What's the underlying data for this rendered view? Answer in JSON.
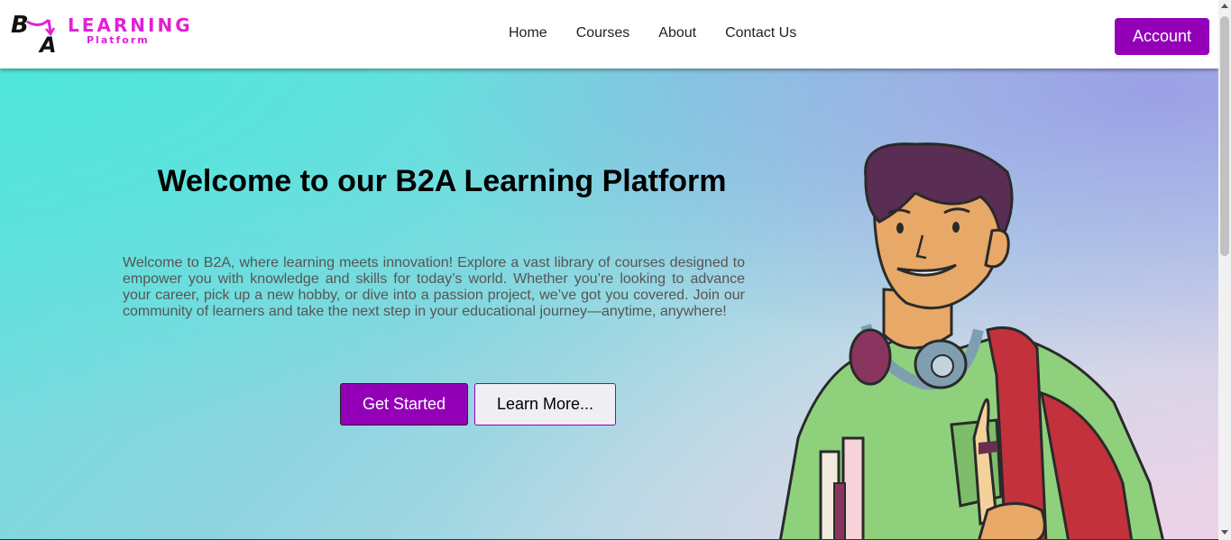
{
  "logo": {
    "mark": "BA",
    "word1": "LEARNING",
    "word2": "Platform"
  },
  "nav": {
    "links": [
      "Home",
      "Courses",
      "About",
      "Contact Us"
    ],
    "account_label": "Account"
  },
  "hero": {
    "title": "Welcome to our B2A Learning Platform",
    "description": "Welcome to B2A, where learning meets innovation! Explore a vast library of courses designed to empower you with knowledge and skills for today’s world. Whether you’re looking to advance your career, pick up a new hobby, or dive into a passion project, we’ve got you covered. Join our community of learners and take the next step in your educational journey—anytime, anywhere!",
    "primary_button": "Get Started",
    "secondary_button": "Learn More..."
  },
  "colors": {
    "accent": "#9400b8",
    "logo": "#e020d8",
    "hero_start": "#5ee6dc",
    "hero_end": "#d6d4ec"
  },
  "icons": {
    "illustration": "student-with-headphones-illustration"
  }
}
